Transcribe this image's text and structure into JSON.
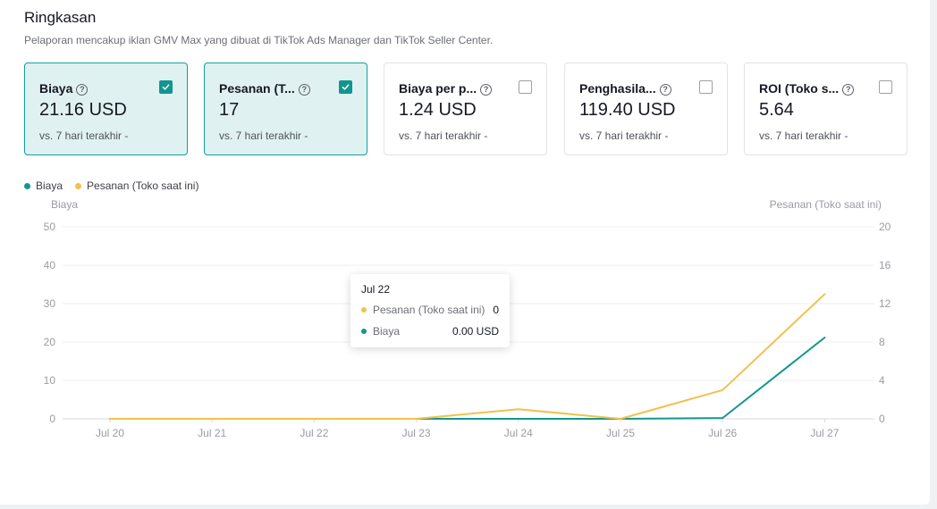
{
  "summary": {
    "title": "Ringkasan",
    "subtitle": "Pelaporan mencakup iklan GMV Max yang dibuat di TikTok Ads Manager dan TikTok Seller Center."
  },
  "cards": [
    {
      "label": "Biaya",
      "value": "21.16 USD",
      "compare": "vs. 7 hari terakhir -",
      "checked": true
    },
    {
      "label": "Pesanan (T...",
      "value": "17",
      "compare": "vs. 7 hari terakhir -",
      "checked": true
    },
    {
      "label": "Biaya per p...",
      "value": "1.24 USD",
      "compare": "vs. 7 hari terakhir -",
      "checked": false
    },
    {
      "label": "Penghasila...",
      "value": "119.40 USD",
      "compare": "vs. 7 hari terakhir -",
      "checked": false
    },
    {
      "label": "ROI (Toko s...",
      "value": "5.64",
      "compare": "vs. 7 hari terakhir -",
      "checked": false
    }
  ],
  "help_glyph": "?",
  "colors": {
    "accent": "#12958e",
    "biaya": "#13978f",
    "pesanan": "#f2c14e",
    "selected_bg": "#dff2f1"
  },
  "legend": [
    {
      "label": "Biaya",
      "color": "#13978f"
    },
    {
      "label": "Pesanan (Toko saat ini)",
      "color": "#f2c14e"
    }
  ],
  "axis_titles": {
    "left": "Biaya",
    "right": "Pesanan (Toko saat ini)"
  },
  "tooltip": {
    "date": "Jul 22",
    "rows": [
      {
        "name": "Pesanan (Toko saat ini)",
        "value": "0",
        "color": "#f2c14e"
      },
      {
        "name": "Biaya",
        "value": "0.00 USD",
        "color": "#13978f"
      }
    ]
  },
  "chart_data": {
    "type": "line",
    "title": "",
    "categories": [
      "Jul 20",
      "Jul 21",
      "Jul 22",
      "Jul 23",
      "Jul 24",
      "Jul 25",
      "Jul 26",
      "Jul 27"
    ],
    "series": [
      {
        "name": "Biaya",
        "axis": "left",
        "color": "#13978f",
        "values": [
          0,
          0,
          0,
          0,
          0,
          0,
          0.2,
          21.16
        ]
      },
      {
        "name": "Pesanan (Toko saat ini)",
        "axis": "right",
        "color": "#f2c14e",
        "values": [
          0,
          0,
          0,
          0,
          1,
          0,
          3,
          13
        ]
      }
    ],
    "y_left": {
      "label": "Biaya",
      "ticks": [
        0,
        10,
        20,
        30,
        40,
        50
      ],
      "range": [
        0,
        50
      ]
    },
    "y_right": {
      "label": "Pesanan (Toko saat ini)",
      "ticks": [
        0,
        4,
        8,
        12,
        16,
        20
      ],
      "range": [
        0,
        20
      ]
    },
    "grid": true,
    "legend": "top-left"
  }
}
